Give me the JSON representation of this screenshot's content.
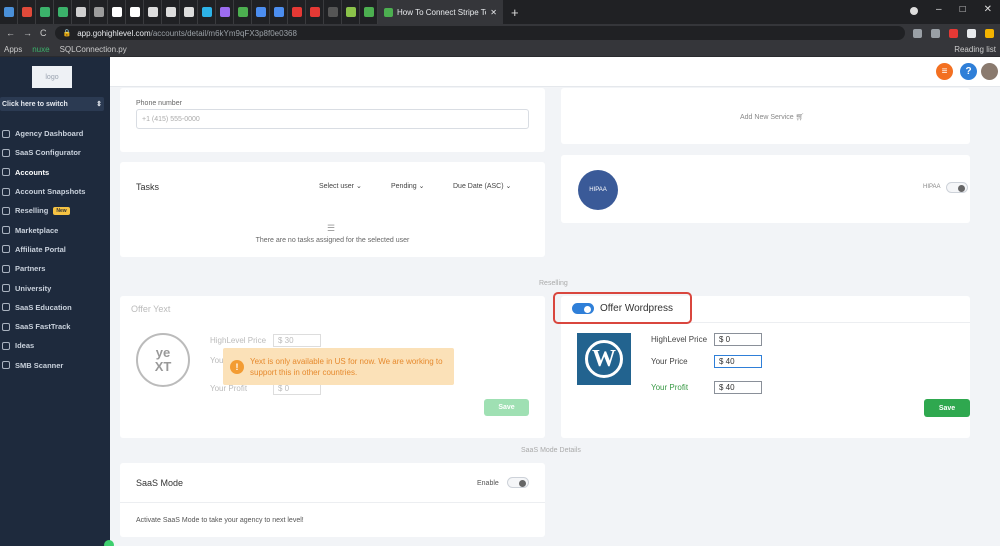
{
  "browser": {
    "active_tab_title": "How To Connect Stripe To Your A",
    "new_tab_symbol": "+",
    "url_secure_symbol": "🔒",
    "url_host": "app.gohighlevel.com",
    "url_path": "/accounts/detail/m6kYm9qFX3p8f0e0368",
    "bookmarks": [
      "Apps",
      "nuxe",
      "SQLConnection.py"
    ],
    "reading_list": "Reading list",
    "nav_back": "←",
    "nav_forward": "→",
    "nav_reload": "C",
    "window_min": "–",
    "window_max": "□",
    "window_close": "✕",
    "tab_colors": [
      "#4a90d9",
      "#e04a3a",
      "#3bb26b",
      "#3bb26b",
      "#d0d0d0",
      "#9c9c9c",
      "#ffffff",
      "#ffffff",
      "#dddddd",
      "#dddddd",
      "#dddddd",
      "#2db3e8",
      "#9c6cf0",
      "#4caf50",
      "#4c8ef0",
      "#4c8ef0",
      "#e53935",
      "#e53935",
      "#555555",
      "#8bc34a",
      "#4caf50"
    ],
    "extension_colors": [
      "#9aa0a6",
      "#9aa0a6",
      "#e53935",
      "#e8eaed",
      "#f4b400"
    ]
  },
  "sidebar": {
    "logo_text": "logo",
    "switcher_label": "Click here to switch",
    "items": [
      {
        "label": "Agency Dashboard",
        "icon": "dashboard-icon"
      },
      {
        "label": "SaaS Configurator",
        "icon": "configurator-icon"
      },
      {
        "label": "Accounts",
        "icon": "accounts-icon",
        "active": true
      },
      {
        "label": "Account Snapshots",
        "icon": "snapshots-icon"
      },
      {
        "label": "Reselling",
        "icon": "reselling-icon",
        "badge": "New"
      },
      {
        "label": "Marketplace",
        "icon": "marketplace-icon"
      },
      {
        "label": "Affiliate Portal",
        "icon": "affiliate-icon"
      },
      {
        "label": "Partners",
        "icon": "partners-icon"
      },
      {
        "label": "University",
        "icon": "university-icon"
      },
      {
        "label": "SaaS Education",
        "icon": "education-icon"
      },
      {
        "label": "SaaS FastTrack",
        "icon": "fasttrack-icon"
      },
      {
        "label": "Ideas",
        "icon": "ideas-icon"
      },
      {
        "label": "SMB Scanner",
        "icon": "scanner-icon"
      }
    ]
  },
  "header": {
    "help_symbol": "?"
  },
  "phone": {
    "label": "Phone number",
    "placeholder": "+1 (415) 555-0000"
  },
  "services": {
    "add_label": "Add New Service",
    "hipaa_label": "HIPAA",
    "hipaa_logo_text": "HIPAA"
  },
  "tasks": {
    "title": "Tasks",
    "filter_user": "Select user",
    "filter_status": "Pending",
    "filter_sort": "Due Date (ASC)",
    "empty_message": "There are no tasks assigned for the selected user"
  },
  "reselling": {
    "section_label": "Reselling",
    "yext": {
      "title": "Offer Yext",
      "logo_top": "ye",
      "logo_bottom": "XT",
      "highlevel_price_label": "HighLevel Price",
      "highlevel_price_value": "$  30",
      "your_price_label": "Your Price",
      "your_profit_label": "Your Profit",
      "your_profit_value": "$  0",
      "warning": "Yext is only available in US for now. We are working to support this in other countries.",
      "save_label": "Save"
    },
    "wordpress": {
      "title": "Offer Wordpress",
      "logo_letter": "W",
      "highlevel_price_label": "HighLevel Price",
      "highlevel_price_value": "$  0",
      "your_price_label": "Your Price",
      "your_price_value": "$  40",
      "your_profit_label": "Your Profit",
      "your_profit_value": "$  40",
      "save_label": "Save"
    }
  },
  "saas": {
    "section_label": "SaaS Mode Details",
    "title": "SaaS Mode",
    "enable_label": "Enable",
    "description": "Activate SaaS Mode to take your agency to next level!"
  },
  "colors": {
    "accent_blue": "#2f7fd8",
    "save_green": "#2fa84f",
    "warning_orange": "#f39c33",
    "highlight_red": "#d9463e",
    "sidebar_bg": "#1e2a3d"
  }
}
